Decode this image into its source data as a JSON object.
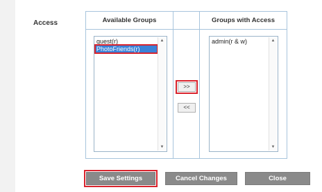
{
  "access_label": "Access",
  "available_groups": {
    "header": "Available Groups",
    "items": [
      "guest(r)",
      "PhotoFriends(r)"
    ]
  },
  "groups_with_access": {
    "header": "Groups with Access",
    "items": [
      "admin(r & w)"
    ]
  },
  "move_buttons": {
    "add": ">>",
    "remove": "<<"
  },
  "actions": {
    "save": "Save Settings",
    "cancel": "Cancel Changes",
    "close": "Close"
  },
  "colors": {
    "highlight": "#d9232d",
    "selection": "#3a82d8",
    "border": "#a7c4dc",
    "button_gray": "#8a8a8a"
  }
}
